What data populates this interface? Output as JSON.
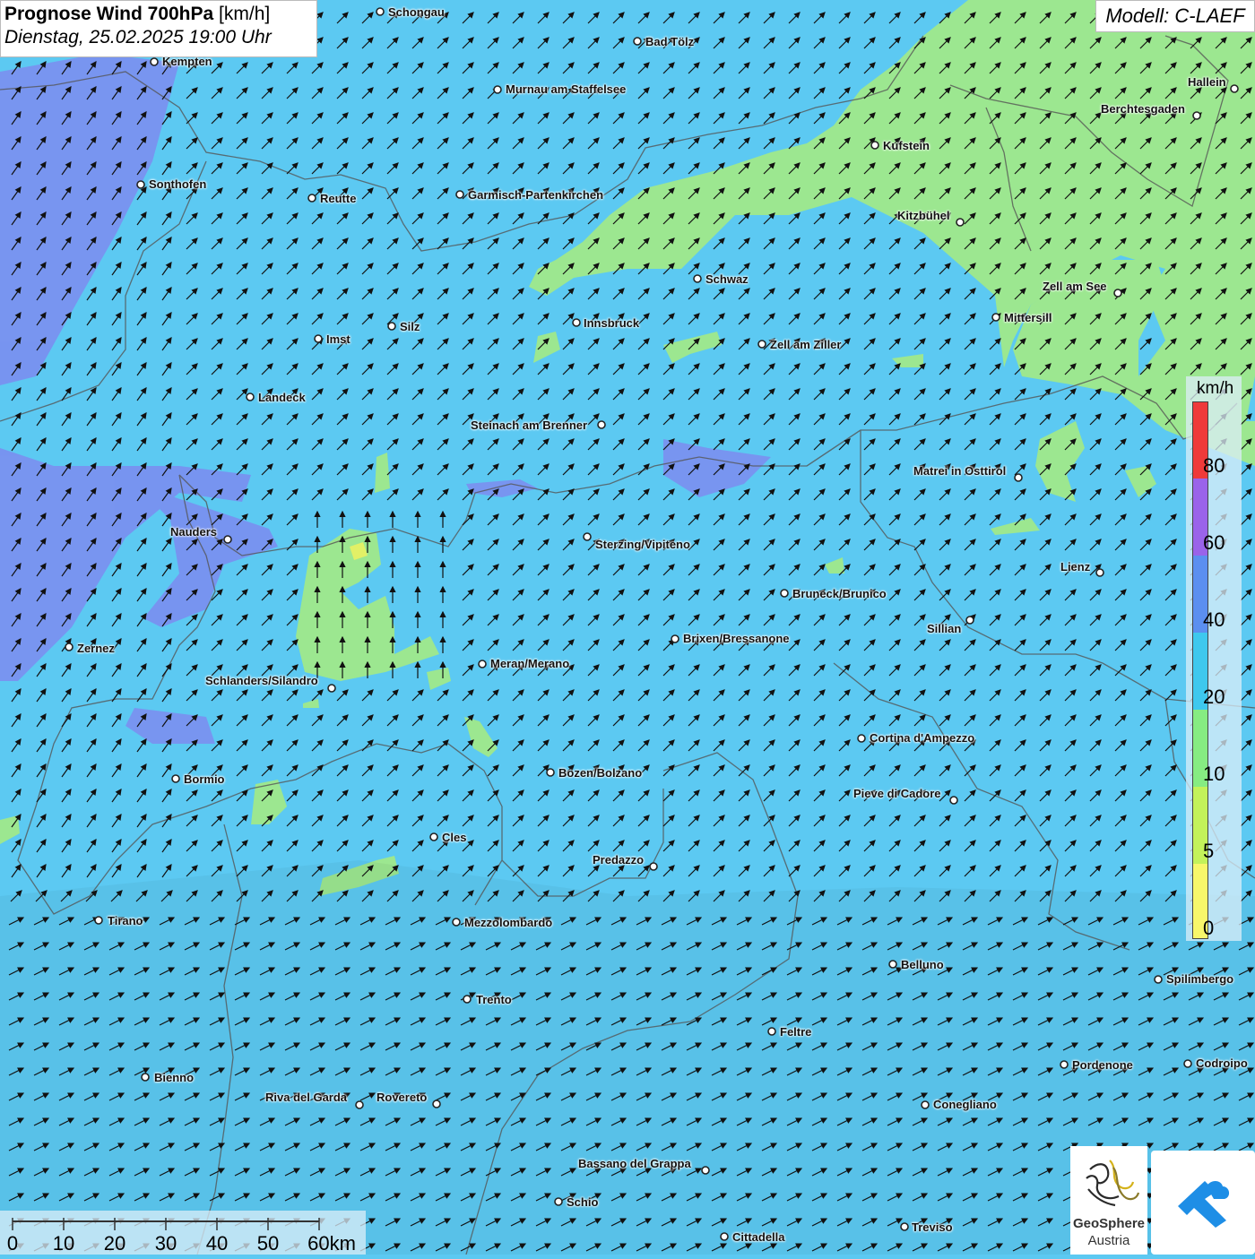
{
  "title": {
    "main": "Prognose Wind 700hPa",
    "unit": "[km/h]",
    "datetime": "Dienstag, 25.02.2025 19:00 Uhr"
  },
  "model": "Modell: C-LAEF",
  "legend": {
    "unit": "km/h",
    "ticks": [
      "0",
      "5",
      "10",
      "20",
      "40",
      "60",
      "80"
    ],
    "bands": [
      {
        "from": 0,
        "to": 5,
        "color": "#f7f76a"
      },
      {
        "from": 5,
        "to": 10,
        "color": "#c3f25a"
      },
      {
        "from": 10,
        "to": 20,
        "color": "#86ec82"
      },
      {
        "from": 20,
        "to": 40,
        "color": "#3ec8ee"
      },
      {
        "from": 40,
        "to": 60,
        "color": "#5b8ff0"
      },
      {
        "from": 60,
        "to": 80,
        "color": "#9a63ea"
      },
      {
        "from": 80,
        "to": 100,
        "color": "#ef3a3a"
      }
    ]
  },
  "colors": {
    "field_base": "#5cc9f2",
    "calm_zone": "#9ce790",
    "strong_zone": "#7b8ff0",
    "border": "#555555"
  },
  "cities": [
    "Schongau",
    "Bad Tölz",
    "Kempten",
    "Murnau am Staffelsee",
    "Hallein",
    "Berchtesgaden",
    "Kufstein",
    "Sonthofen",
    "Reutte",
    "Garmisch-Partenkirchen",
    "Kitzbühel",
    "Schwaz",
    "Zell am See",
    "Innsbruck",
    "Mittersill",
    "Imst",
    "Silz",
    "Zell am Ziller",
    "Landeck",
    "Steinach am Brenner",
    "Matrei in Osttirol",
    "Nauders",
    "Sterzing/Vipiteno",
    "Lienz",
    "Bruneck/Brunico",
    "Sillian",
    "Brixen/Bressanone",
    "Zernez",
    "Meran/Merano",
    "Schlanders/Silandro",
    "Cortina d'Ampezzo",
    "Bozen/Bolzano",
    "Bormio",
    "Pieve di Cadore",
    "Cles",
    "Predazzo",
    "Tirano",
    "Mezzolombardo",
    "Belluno",
    "Spilimbergo",
    "Trento",
    "Feltre",
    "Pordenone",
    "Codroipo",
    "Bienno",
    "Riva del Garda",
    "Rovereto",
    "Conegliano",
    "Bassano del Grappa",
    "Schio",
    "Treviso",
    "Cittadella"
  ],
  "scale": {
    "ticks": [
      "0",
      "10",
      "20",
      "30",
      "40",
      "50",
      "60km"
    ]
  },
  "logos": {
    "provider_name": "GeoSphere",
    "provider_sub": "Austria"
  }
}
